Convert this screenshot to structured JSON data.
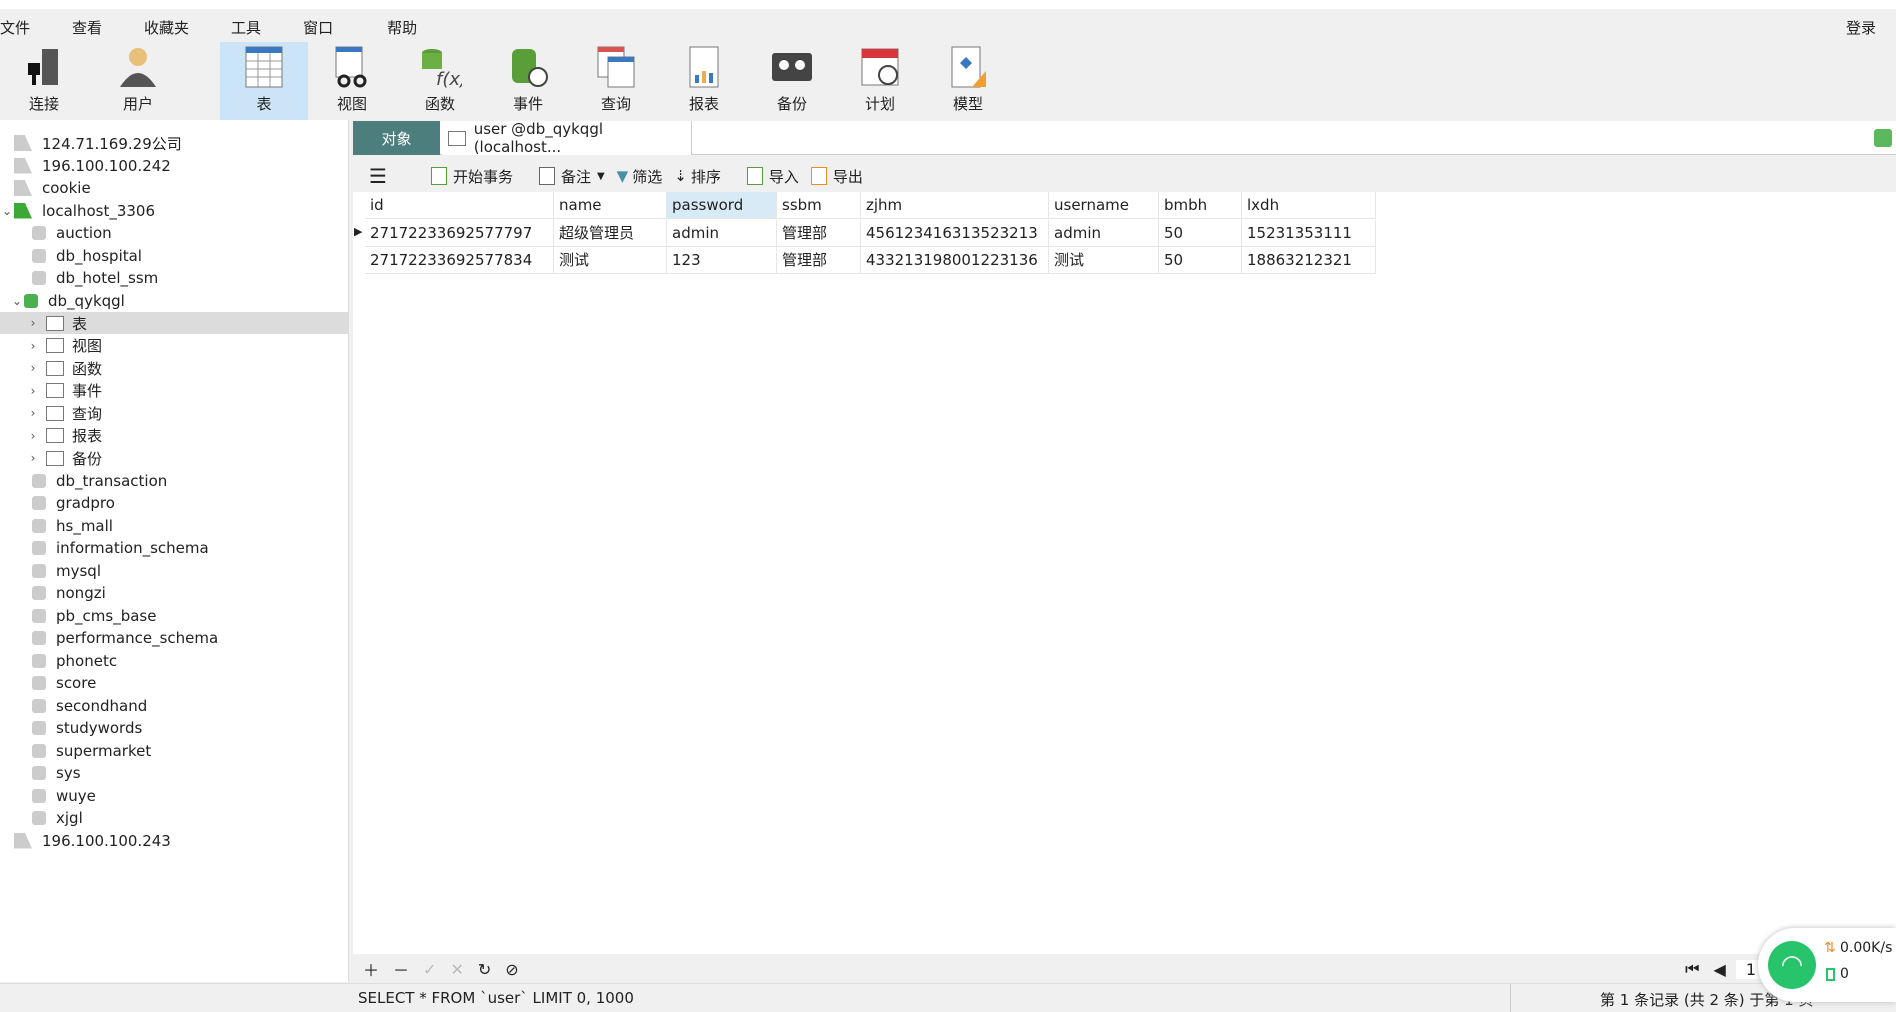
{
  "menu": [
    "文件",
    "查看",
    "收藏夹",
    "工具",
    "窗口",
    "帮助"
  ],
  "login": "登录",
  "toolbar": [
    {
      "label": "连接",
      "icon": "plug-icon"
    },
    {
      "label": "用户",
      "icon": "user-icon"
    },
    {
      "label": "表",
      "icon": "table-icon"
    },
    {
      "label": "视图",
      "icon": "view-icon"
    },
    {
      "label": "函数",
      "icon": "function-icon"
    },
    {
      "label": "事件",
      "icon": "event-icon"
    },
    {
      "label": "查询",
      "icon": "query-icon"
    },
    {
      "label": "报表",
      "icon": "report-icon"
    },
    {
      "label": "备份",
      "icon": "backup-icon"
    },
    {
      "label": "计划",
      "icon": "schedule-icon"
    },
    {
      "label": "模型",
      "icon": "model-icon"
    }
  ],
  "tree": {
    "connections_top": [
      "124.71.169.29公司",
      "196.100.100.242",
      "cookie"
    ],
    "localhost": "localhost_3306",
    "dbs_before": [
      "auction",
      "db_hospital",
      "db_hotel_ssm"
    ],
    "open_db": "db_qykqgl",
    "open_children": [
      "表",
      "视图",
      "函数",
      "事件",
      "查询",
      "报表",
      "备份"
    ],
    "dbs_after": [
      "db_transaction",
      "gradpro",
      "hs_mall",
      "information_schema",
      "mysql",
      "nongzi",
      "pb_cms_base",
      "performance_schema",
      "phonetc",
      "score",
      "secondhand",
      "studywords",
      "supermarket",
      "sys",
      "wuye",
      "xjgl"
    ],
    "connection_bottom": "196.100.100.243"
  },
  "tabs": {
    "objects": "对象",
    "user": "user @db_qykqgl (localhost..."
  },
  "subtoolbar": {
    "begin": "开始事务",
    "note": "备注",
    "filter": "筛选",
    "sort": "排序",
    "import": "导入",
    "export": "导出"
  },
  "grid": {
    "columns": [
      "id",
      "name",
      "password",
      "ssbm",
      "zjhm",
      "username",
      "bmbh",
      "lxdh"
    ],
    "rows": [
      [
        "27172233692577797",
        "超级管理员",
        "admin",
        "管理部",
        "456123416313523213",
        "admin",
        "50",
        "15231353111"
      ],
      [
        "27172233692577834",
        "测试",
        "123",
        "管理部",
        "433213198001223136",
        "测试",
        "50",
        "18863212321"
      ]
    ]
  },
  "page": "1",
  "status": {
    "sql": "SELECT * FROM `user` LIMIT 0, 1000",
    "record": "第 1 条记录 (共 2 条) 于第 1 页"
  },
  "net": {
    "speed": "0.00K/s",
    "count": "0",
    "color": "#27c46b"
  }
}
